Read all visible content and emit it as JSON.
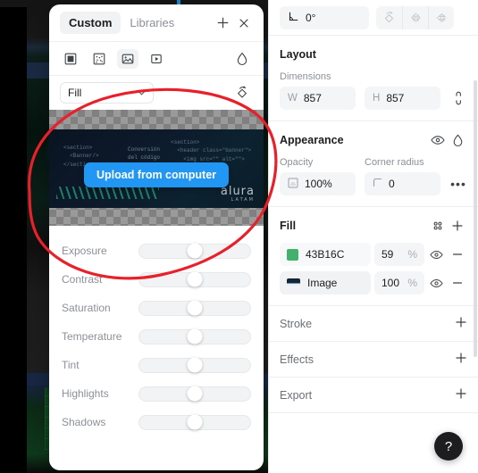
{
  "left_panel": {
    "tabs": [
      {
        "label": "Custom",
        "active": true
      },
      {
        "label": "Libraries",
        "active": false
      }
    ],
    "header_icons": [
      {
        "name": "add-icon",
        "glyph": "+"
      },
      {
        "name": "close-icon",
        "glyph": "×"
      }
    ],
    "fill_type_tools": [
      {
        "name": "solid-fill-icon",
        "active": false
      },
      {
        "name": "pattern-fill-icon",
        "active": false
      },
      {
        "name": "image-fill-icon",
        "active": true
      },
      {
        "name": "video-fill-icon",
        "active": false
      }
    ],
    "eyedropper_label": "droplet-icon",
    "scale_mode": {
      "value": "Fill",
      "chevron": "⌄"
    },
    "preview": {
      "upload_button": "Upload from computer",
      "code_left": "<section>\n  <Banner/>\n</section>",
      "code_mid": "Conversión\ndel código",
      "code_right": "<section>\n  <header class=\"banner\">\n    <img src=\"\" alt=\"\">\n    <p></p>",
      "logo": "alura",
      "logo_sub": "LATAM"
    },
    "adjustments": [
      {
        "label": "Exposure",
        "value": 50
      },
      {
        "label": "Contrast",
        "value": 50
      },
      {
        "label": "Saturation",
        "value": 50
      },
      {
        "label": "Temperature",
        "value": 50
      },
      {
        "label": "Tint",
        "value": 50
      },
      {
        "label": "Highlights",
        "value": 50
      },
      {
        "label": "Shadows",
        "value": 50
      }
    ]
  },
  "inspector": {
    "rotation": {
      "value": "0°",
      "icon": "angle-icon"
    },
    "transform_icons": [
      {
        "name": "rotate-icon"
      },
      {
        "name": "flip-horizontal-icon"
      },
      {
        "name": "flip-vertical-icon"
      }
    ],
    "layout": {
      "title": "Layout",
      "dimensions_label": "Dimensions",
      "width_label": "W",
      "width_value": "857",
      "height_label": "H",
      "height_value": "857",
      "link_icon": "link-ratio-icon"
    },
    "appearance": {
      "title": "Appearance",
      "opacity_label": "Opacity",
      "opacity_value": "100%",
      "corner_radius_label": "Corner radius",
      "corner_radius_value": "0",
      "more_glyph": "•••"
    },
    "fill": {
      "title": "Fill",
      "add_glyph": "+",
      "grid_icon": "fill-grid-icon",
      "items": [
        {
          "name": "43B16C",
          "opacity": "59",
          "unit": "%",
          "color": "#43B16C",
          "type": "color"
        },
        {
          "name": "Image",
          "opacity": "100",
          "unit": "%",
          "type": "image"
        }
      ]
    },
    "collapsed_sections": [
      {
        "title": "Stroke",
        "add": "+"
      },
      {
        "title": "Effects",
        "add": "+"
      },
      {
        "title": "Export",
        "add": "+"
      }
    ],
    "help_button": "?"
  },
  "annotation": {
    "color": "#e8202a",
    "shape": "ellipse"
  }
}
